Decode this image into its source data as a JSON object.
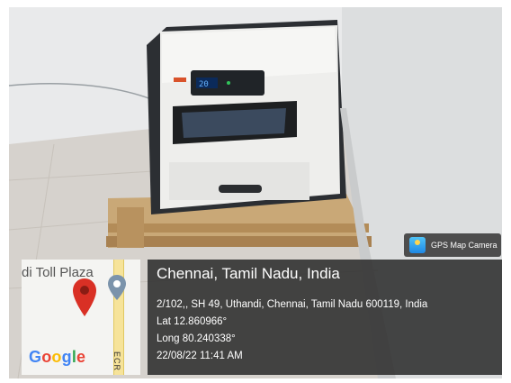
{
  "badge": {
    "label": "GPS Map Camera",
    "icon": "gps-map-camera-app-icon"
  },
  "map": {
    "place_label": "di Toll Plaza",
    "road_label": "ECR",
    "logo_text": "Google",
    "logo_colors": [
      "#4285F4",
      "#EA4335",
      "#FBBC05",
      "#4285F4",
      "#34A853",
      "#EA4335"
    ],
    "pin_color": "#D93025",
    "poi_color": "#7B93AB"
  },
  "location": {
    "title": "Chennai, Tamil Nadu, India",
    "address": "2/102,, SH 49, Uthandi, Chennai, Tamil Nadu 600119, India",
    "lat": "Lat 12.860966°",
    "long": "Long 80.240338°",
    "datetime": "22/08/22 11:41 AM"
  },
  "device": {
    "display_value": "20"
  }
}
